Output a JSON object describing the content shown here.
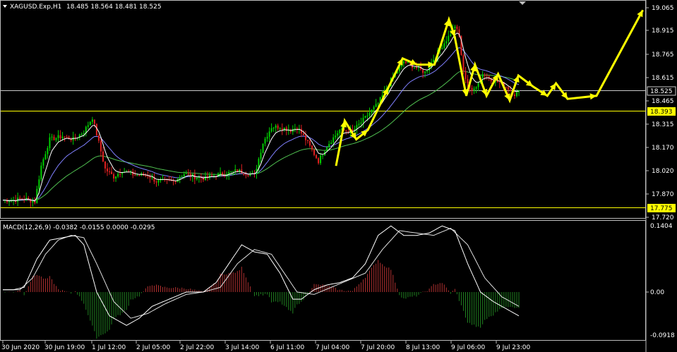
{
  "header": {
    "menu_icon": "triangle-down-icon",
    "symbol": "XAGUSD.Exp,H1",
    "ohlc": "18.485 18.564 18.481 18.525"
  },
  "price_axis": {
    "ticks": [
      "19.065",
      "18.915",
      "18.765",
      "18.615",
      "18.465",
      "18.315",
      "18.170",
      "18.020",
      "17.870",
      "17.720"
    ],
    "current_price": "18.525",
    "level_upper": "18.393",
    "level_lower": "17.775"
  },
  "macd": {
    "label": "MACD(12,26,9) -0.0382 -0.0155 0.0000 -0.0295",
    "ticks": [
      "0.1404",
      "0.00",
      "-0.0918"
    ]
  },
  "time_axis": [
    "30 Jun 2020",
    "30 Jun 19:00",
    "1 Jul 12:00",
    "2 Jul 05:00",
    "2 Jul 22:00",
    "3 Jul 14:00",
    "6 Jul 11:00",
    "7 Jul 04:00",
    "7 Jul 20:00",
    "8 Jul 13:00",
    "9 Jul 06:00",
    "9 Jul 23:00"
  ],
  "colors": {
    "background": "#000000",
    "bull": "#00d000",
    "bear": "#e02020",
    "projection": "#ffff00",
    "level": "#ffff00",
    "price_line": "#c8c8c8",
    "ma_fast": "#ffffff",
    "ma_mid": "#8080ff",
    "ma_slow": "#50c050",
    "macd_pos": "#b03030",
    "macd_neg": "#208020"
  },
  "chart_data": {
    "type": "candlestick",
    "symbol": "XAGUSD",
    "timeframe": "H1",
    "price_range": [
      17.72,
      19.065
    ],
    "close_path": [
      [
        0,
        17.83
      ],
      [
        5,
        17.83
      ],
      [
        10,
        17.84
      ],
      [
        15,
        17.82
      ],
      [
        18,
        18.05
      ],
      [
        22,
        18.22
      ],
      [
        28,
        18.24
      ],
      [
        33,
        18.22
      ],
      [
        38,
        18.27
      ],
      [
        42,
        18.36
      ],
      [
        45,
        18.2
      ],
      [
        48,
        18.03
      ],
      [
        52,
        17.98
      ],
      [
        56,
        18.02
      ],
      [
        62,
        17.99
      ],
      [
        68,
        17.99
      ],
      [
        72,
        17.95
      ],
      [
        76,
        17.95
      ],
      [
        80,
        17.95
      ],
      [
        85,
        18.0
      ],
      [
        90,
        17.98
      ],
      [
        95,
        17.97
      ],
      [
        100,
        17.99
      ],
      [
        105,
        18.0
      ],
      [
        110,
        18.02
      ],
      [
        115,
        18.0
      ],
      [
        118,
        17.99
      ],
      [
        122,
        18.2
      ],
      [
        126,
        18.3
      ],
      [
        130,
        18.3
      ],
      [
        135,
        18.28
      ],
      [
        138,
        18.3
      ],
      [
        142,
        18.22
      ],
      [
        145,
        18.15
      ],
      [
        148,
        18.08
      ],
      [
        152,
        18.18
      ],
      [
        158,
        18.28
      ],
      [
        164,
        18.27
      ],
      [
        170,
        18.36
      ],
      [
        176,
        18.45
      ],
      [
        182,
        18.6
      ],
      [
        188,
        18.72
      ],
      [
        194,
        18.68
      ],
      [
        198,
        18.65
      ],
      [
        204,
        18.78
      ],
      [
        210,
        18.9
      ],
      [
        212,
        18.95
      ],
      [
        214,
        18.88
      ],
      [
        216,
        18.65
      ],
      [
        220,
        18.52
      ],
      [
        225,
        18.64
      ],
      [
        230,
        18.6
      ],
      [
        235,
        18.57
      ],
      [
        240,
        18.51
      ],
      [
        242,
        18.525
      ]
    ],
    "projection": [
      [
        0,
        18.05
      ],
      [
        3,
        18.34
      ],
      [
        7,
        18.22
      ],
      [
        11,
        18.28
      ],
      [
        18,
        18.55
      ],
      [
        23,
        18.74
      ],
      [
        28,
        18.7
      ],
      [
        34,
        18.7
      ],
      [
        39,
        18.99
      ],
      [
        41,
        18.88
      ],
      [
        45,
        18.5
      ],
      [
        48,
        18.7
      ],
      [
        52,
        18.5
      ],
      [
        56,
        18.64
      ],
      [
        60,
        18.47
      ],
      [
        63,
        18.63
      ],
      [
        68,
        18.56
      ],
      [
        73,
        18.5
      ],
      [
        76,
        18.58
      ],
      [
        80,
        18.48
      ],
      [
        90,
        18.5
      ],
      [
        106,
        19.05
      ]
    ],
    "macd_range": [
      -0.0918,
      0.1404
    ],
    "macd_main": [
      [
        0,
        0.005
      ],
      [
        5,
        0.005
      ],
      [
        10,
        0.01
      ],
      [
        16,
        0.07
      ],
      [
        22,
        0.11
      ],
      [
        28,
        0.115
      ],
      [
        34,
        0.12
      ],
      [
        38,
        0.1
      ],
      [
        44,
        0.0
      ],
      [
        50,
        -0.05
      ],
      [
        58,
        -0.07
      ],
      [
        64,
        -0.055
      ],
      [
        70,
        -0.03
      ],
      [
        78,
        -0.015
      ],
      [
        86,
        0.0
      ],
      [
        94,
        0.0
      ],
      [
        100,
        0.02
      ],
      [
        106,
        0.06
      ],
      [
        112,
        0.1
      ],
      [
        118,
        0.085
      ],
      [
        124,
        0.08
      ],
      [
        130,
        0.04
      ],
      [
        136,
        -0.015
      ],
      [
        140,
        -0.015
      ],
      [
        146,
        0.005
      ],
      [
        152,
        0.015
      ],
      [
        158,
        0.02
      ],
      [
        164,
        0.03
      ],
      [
        170,
        0.06
      ],
      [
        176,
        0.12
      ],
      [
        182,
        0.14
      ],
      [
        188,
        0.12
      ],
      [
        194,
        0.12
      ],
      [
        200,
        0.125
      ],
      [
        206,
        0.14
      ],
      [
        212,
        0.13
      ],
      [
        218,
        0.06
      ],
      [
        224,
        0.0
      ],
      [
        230,
        -0.02
      ],
      [
        242,
        -0.05
      ]
    ],
    "macd_signal": [
      [
        0,
        0.005
      ],
      [
        8,
        0.005
      ],
      [
        14,
        0.03
      ],
      [
        20,
        0.08
      ],
      [
        26,
        0.11
      ],
      [
        32,
        0.12
      ],
      [
        38,
        0.115
      ],
      [
        44,
        0.06
      ],
      [
        52,
        -0.02
      ],
      [
        60,
        -0.055
      ],
      [
        68,
        -0.045
      ],
      [
        76,
        -0.025
      ],
      [
        86,
        -0.005
      ],
      [
        94,
        0.0
      ],
      [
        102,
        0.01
      ],
      [
        110,
        0.06
      ],
      [
        118,
        0.09
      ],
      [
        126,
        0.08
      ],
      [
        132,
        0.04
      ],
      [
        138,
        0.0
      ],
      [
        146,
        -0.005
      ],
      [
        154,
        0.01
      ],
      [
        162,
        0.025
      ],
      [
        170,
        0.04
      ],
      [
        178,
        0.09
      ],
      [
        186,
        0.13
      ],
      [
        194,
        0.125
      ],
      [
        202,
        0.12
      ],
      [
        210,
        0.135
      ],
      [
        218,
        0.1
      ],
      [
        226,
        0.03
      ],
      [
        234,
        -0.01
      ],
      [
        242,
        -0.03
      ]
    ]
  }
}
